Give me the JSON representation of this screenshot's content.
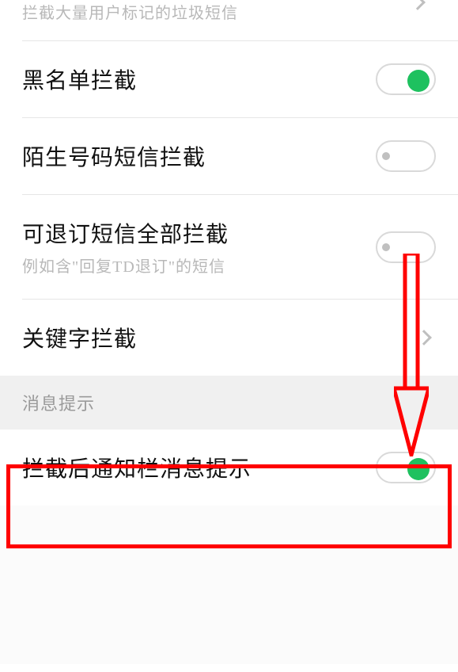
{
  "items": {
    "spam": {
      "subtitle": "拦截大量用户标记的垃圾短信"
    },
    "blacklist": {
      "title": "黑名单拦截",
      "toggle": "on"
    },
    "stranger": {
      "title": "陌生号码短信拦截",
      "toggle": "off"
    },
    "unsubscribe": {
      "title": "可退订短信全部拦截",
      "subtitle": "例如含\"回复TD退订\"的短信",
      "toggle": "off"
    },
    "keyword": {
      "title": "关键字拦截"
    }
  },
  "section": {
    "notifications": "消息提示"
  },
  "notify_item": {
    "title": "拦截后通知栏消息提示",
    "toggle": "on"
  },
  "colors": {
    "accent": "#1ec15f",
    "highlight": "#ff0000"
  }
}
